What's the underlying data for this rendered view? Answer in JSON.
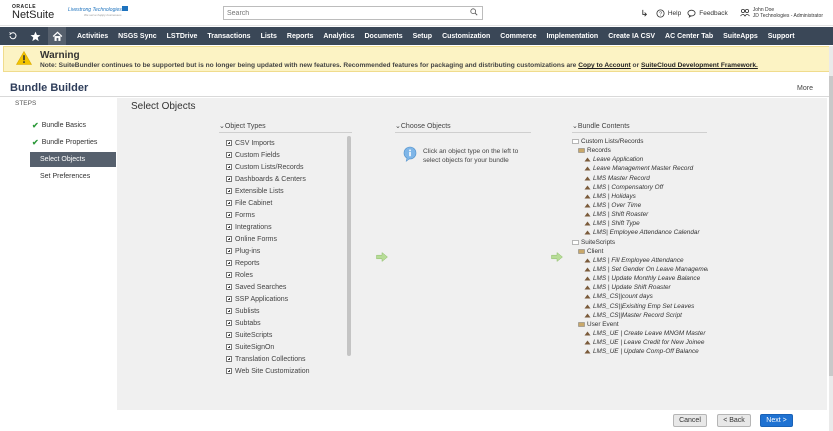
{
  "header": {
    "logo_top": "ORACLE",
    "logo_main": "NetSuite",
    "company_name": "Livestrong Technologies",
    "company_sub": "We serve happy businesses",
    "search_placeholder": "Search",
    "help_label": "Help",
    "feedback_label": "Feedback",
    "user_name": "John Doe",
    "user_role": "JD Technologies - Administrator"
  },
  "nav": {
    "items": [
      "Activities",
      "NSGS Sync",
      "LSTDrive",
      "Transactions",
      "Lists",
      "Reports",
      "Analytics",
      "Documents",
      "Setup",
      "Customization",
      "Commerce",
      "Implementation",
      "Create IA CSV",
      "AC Center Tab",
      "SuiteApps",
      "Support"
    ]
  },
  "warning": {
    "title": "Warning",
    "message_prefix": "Note: SuiteBundler continues to be supported but is no longer being updated with new features. Recommended features for packaging and distributing customizations are ",
    "link1": "Copy to Account",
    "message_mid": " or ",
    "link2": "SuiteCloud Development Framework.",
    "bg_color": "#fcf3c4"
  },
  "page": {
    "title": "Bundle Builder",
    "more_label": "More",
    "steps_label": "STEPS",
    "main_title": "Select Objects"
  },
  "steps": [
    {
      "label": "Bundle Basics",
      "done": true
    },
    {
      "label": "Bundle Properties",
      "done": true
    },
    {
      "label": "Select Objects",
      "active": true
    },
    {
      "label": "Set Preferences"
    }
  ],
  "columns": {
    "types_header": "Object Types",
    "choose_header": "Choose Objects",
    "contents_header": "Bundle Contents",
    "choose_hint": "Click an object type on the left to select objects for your bundle"
  },
  "object_types": [
    "CSV Imports",
    "Custom Fields",
    "Custom Lists/Records",
    "Dashboards & Centers",
    "Extensible Lists",
    "File Cabinet",
    "Forms",
    "Integrations",
    "Online Forms",
    "Plug-ins",
    "Reports",
    "Roles",
    "Saved Searches",
    "SSP Applications",
    "Sublists",
    "Subtabs",
    "SuiteScripts",
    "SuiteSignOn",
    "Translation Collections",
    "Web Site Customization"
  ],
  "bundle_contents": [
    {
      "level": 0,
      "label": "Custom Lists/Records",
      "kind": "folder"
    },
    {
      "level": 1,
      "label": "Records",
      "kind": "folder"
    },
    {
      "level": 2,
      "label": "Leave Application"
    },
    {
      "level": 2,
      "label": "Leave Management Master Record"
    },
    {
      "level": 2,
      "label": "LMS Master Record"
    },
    {
      "level": 2,
      "label": "LMS | Compensatory Off"
    },
    {
      "level": 2,
      "label": "LMS | Holidays"
    },
    {
      "level": 2,
      "label": "LMS | Over Time"
    },
    {
      "level": 2,
      "label": "LMS | Shift Roaster"
    },
    {
      "level": 2,
      "label": "LMS | Shift Type"
    },
    {
      "level": 2,
      "label": "LMS| Employee Attendance Calendar"
    },
    {
      "level": 0,
      "label": "SuiteScripts",
      "kind": "folder"
    },
    {
      "level": 1,
      "label": "Client",
      "kind": "folder"
    },
    {
      "level": 2,
      "label": "LMS | Fill Employee Attendance"
    },
    {
      "level": 2,
      "label": "LMS | Set Gender On Leave Management"
    },
    {
      "level": 2,
      "label": "LMS | Update Monthly Leave Balance"
    },
    {
      "level": 2,
      "label": "LMS | Update Shift Roaster"
    },
    {
      "level": 2,
      "label": "LMS_CS||count days"
    },
    {
      "level": 2,
      "label": "LMS_CS||Exisiting Emp Set Leaves"
    },
    {
      "level": 2,
      "label": "LMS_CS||Master Record Script"
    },
    {
      "level": 1,
      "label": "User Event",
      "kind": "folder"
    },
    {
      "level": 2,
      "label": "LMS_UE | Create Leave MNGM Master"
    },
    {
      "level": 2,
      "label": "LMS_UE | Leave Credit for New Joinee"
    },
    {
      "level": 2,
      "label": "LMS_UE | Update Comp-Off Balance"
    }
  ],
  "buttons": {
    "cancel": "Cancel",
    "back": "< Back",
    "next": "Next >"
  },
  "colors": {
    "nav_bg": "#3a4757",
    "accent_blue": "#1f72d2",
    "title_color": "#2e3d5a",
    "check_green": "#2e9a3b"
  }
}
